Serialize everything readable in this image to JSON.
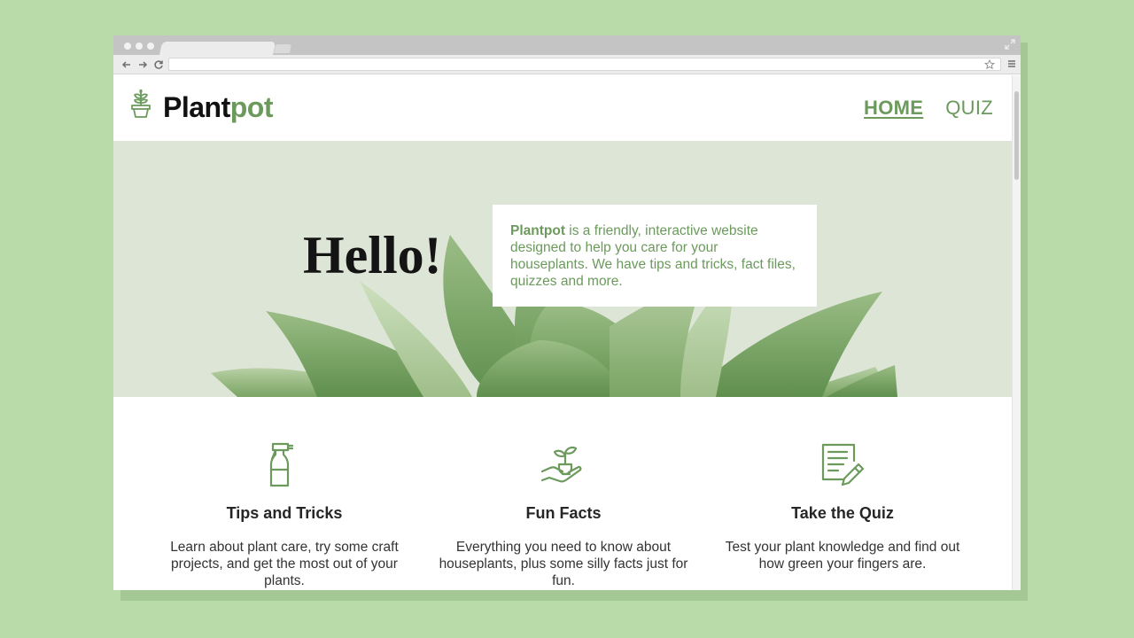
{
  "site": {
    "logo_part1": "Plant",
    "logo_part2": "pot"
  },
  "nav": {
    "home": "HOME",
    "quiz": "QUIZ"
  },
  "hero": {
    "heading": "Hello!",
    "intro_bold": "Plantpot",
    "intro_rest": " is a friendly, interactive website designed to help you care for your houseplants. We have tips and tricks, fact files, quizzes and more."
  },
  "features": [
    {
      "icon": "spray-bottle-icon",
      "title": "Tips and Tricks",
      "text": "Learn about plant care, try some craft projects, and get the most out of your plants."
    },
    {
      "icon": "seedling-hand-icon",
      "title": "Fun Facts",
      "text": "Everything you need to know about houseplants, plus some silly facts just for fun."
    },
    {
      "icon": "quiz-pencil-icon",
      "title": "Take the Quiz",
      "text": "Test your plant knowledge and find out how green your fingers are."
    }
  ],
  "colors": {
    "accent": "#6b9a5c",
    "hero_bg": "#dde6d6",
    "page_bg": "#b9dbaa"
  }
}
